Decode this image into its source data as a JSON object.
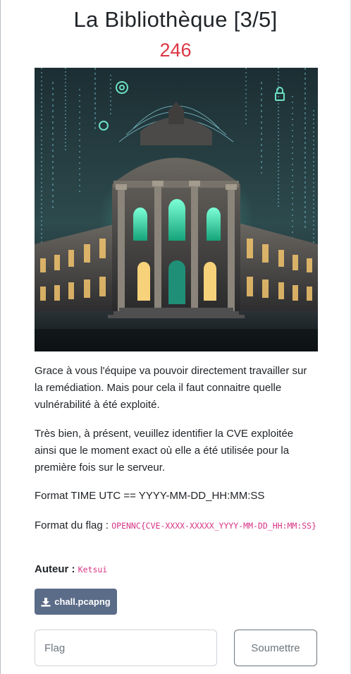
{
  "challenge": {
    "title": "La Bibliothèque [3/5]",
    "points": "246"
  },
  "description": {
    "paragraph1": "Grace à vous l'équipe va pouvoir directement travailler sur la remédiation. Mais pour cela il faut connaitre quelle vulnérabilité à été exploité.",
    "paragraph2": "Très bien, à présent, veuillez identifier la CVE exploitée ainsi que le moment exact où elle a été utilisée pour la première fois sur le serveur.",
    "time_format": "Format TIME UTC == YYYY-MM-DD_HH:MM:SS",
    "flag_format_label": "Format du flag :",
    "flag_format_value": "OPENNC{CVE-XXXX-XXXXX_YYYY-MM-DD_HH:MM:SS}",
    "author_label": "Auteur :",
    "author_value": "Ketsui"
  },
  "file_button": {
    "label": "chall.pcapng",
    "icon": "download-icon"
  },
  "flag_form": {
    "placeholder": "Flag",
    "value": "",
    "submit_label": "Soumettre"
  },
  "colors": {
    "points": "#dc3545",
    "code": "#d63384",
    "file_button_bg": "#5a6c88",
    "submit_border": "#6c757d"
  }
}
